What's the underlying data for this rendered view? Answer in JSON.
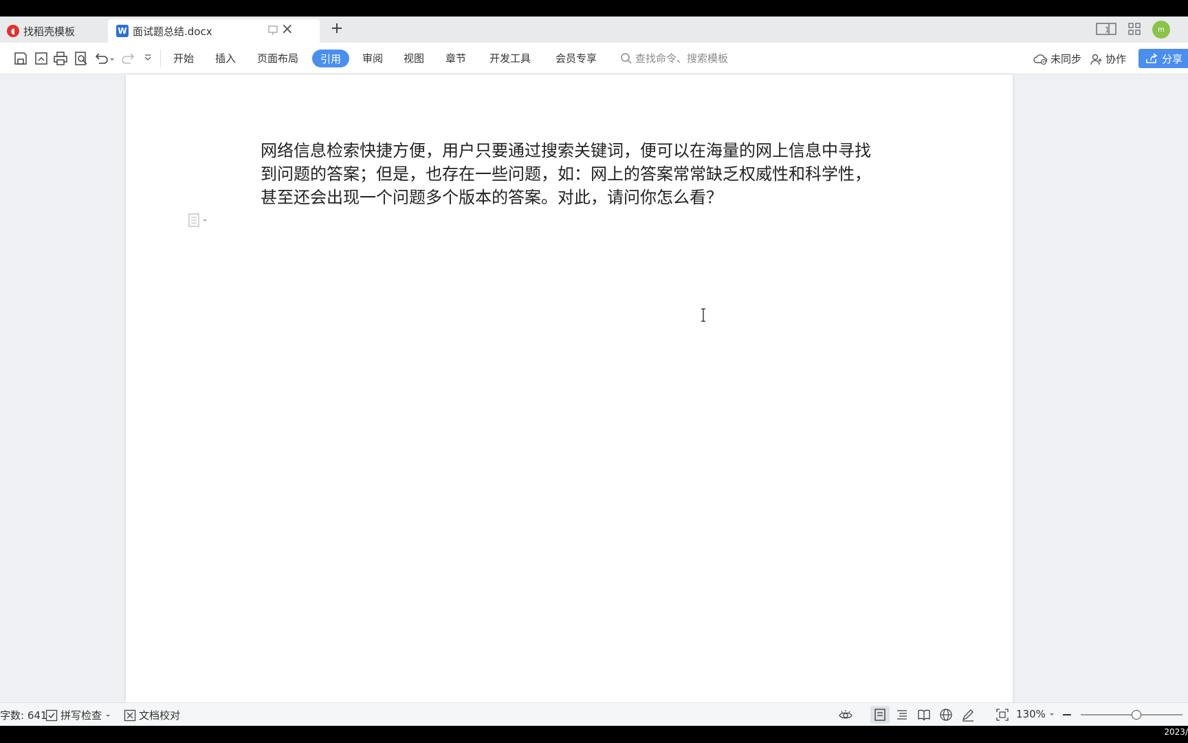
{
  "tabs": [
    {
      "label": "找稻壳模板",
      "icon": "daoke-logo-icon"
    },
    {
      "label": "面试题总结.docx",
      "icon": "wps-writer-icon",
      "active": true
    }
  ],
  "menu": {
    "items": [
      "开始",
      "插入",
      "页面布局",
      "引用",
      "审阅",
      "视图",
      "章节",
      "开发工具",
      "会员专享"
    ],
    "active": "引用"
  },
  "search": {
    "placeholder": "查找命令、搜索模板"
  },
  "toolbar_right": {
    "sync_label": "未同步",
    "collab_label": "协作",
    "share_label": "分享"
  },
  "document": {
    "paragraph": "网络信息检索快捷方便，用户只要通过搜索关键词，便可以在海量的网上信息中寻找到问题的答案；但是，也存在一些问题，如：网上的答案常常缺乏权威性和科学性，甚至还会出现一个问题多个版本的答案。对此，请问你怎么看？"
  },
  "status": {
    "word_count": "字数: 641",
    "spell_check": "拼写检查",
    "proofread": "文档校对",
    "zoom": "130%",
    "zoom_level_fraction": 0.55
  },
  "clock": "2023/",
  "avatar_text": "m",
  "colors": {
    "accent": "#4a8ef0",
    "page_bg": "#eef0f3"
  }
}
